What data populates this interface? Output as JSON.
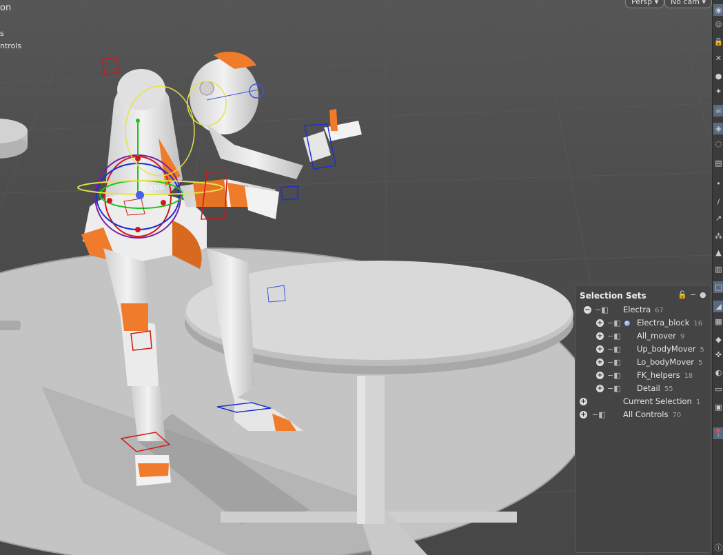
{
  "viewport": {
    "title_fragment": "on",
    "subtitle_fragment": "s",
    "controls_fragment": "ntrols",
    "camera_mode": "Persp",
    "camera_select": "No cam",
    "dropdown_glyph": "▾"
  },
  "object_label": "COG",
  "toolbar": {
    "icons": [
      "eye-icon",
      "spiral-icon",
      "lock-icon",
      "x-bones-icon",
      "sphere-icon",
      "light-icon",
      "skeleton-icon",
      "camera-icon",
      "eye-closed-icon",
      "film-icon",
      "dot-icon",
      "bone-icon",
      "pin-icon",
      "joints-icon",
      "mesh-icon",
      "grid-icon",
      "box-icon",
      "pose-icon",
      "swatch-icon",
      "cube-icon",
      "rig-icon",
      "node-icon",
      "frame-icon",
      "monitor-icon",
      "map-pin-icon",
      "info-icon"
    ]
  },
  "selection_sets": {
    "title": "Selection Sets",
    "items": [
      {
        "label": "Electra",
        "count": "67",
        "expander": "−"
      },
      {
        "label": "Electra_block",
        "count": "16",
        "expander": "+"
      },
      {
        "label": "All_mover",
        "count": "9",
        "expander": "+"
      },
      {
        "label": "Up_bodyMover",
        "count": "5",
        "expander": "+"
      },
      {
        "label": "Lo_bodyMover",
        "count": "5",
        "expander": "+"
      },
      {
        "label": "FK_helpers",
        "count": "18",
        "expander": "+"
      },
      {
        "label": "Detail",
        "count": "55",
        "expander": "+"
      },
      {
        "label": "Current Selection",
        "count": "1",
        "expander": "+"
      },
      {
        "label": "All Controls",
        "count": "70",
        "expander": "+"
      }
    ]
  }
}
